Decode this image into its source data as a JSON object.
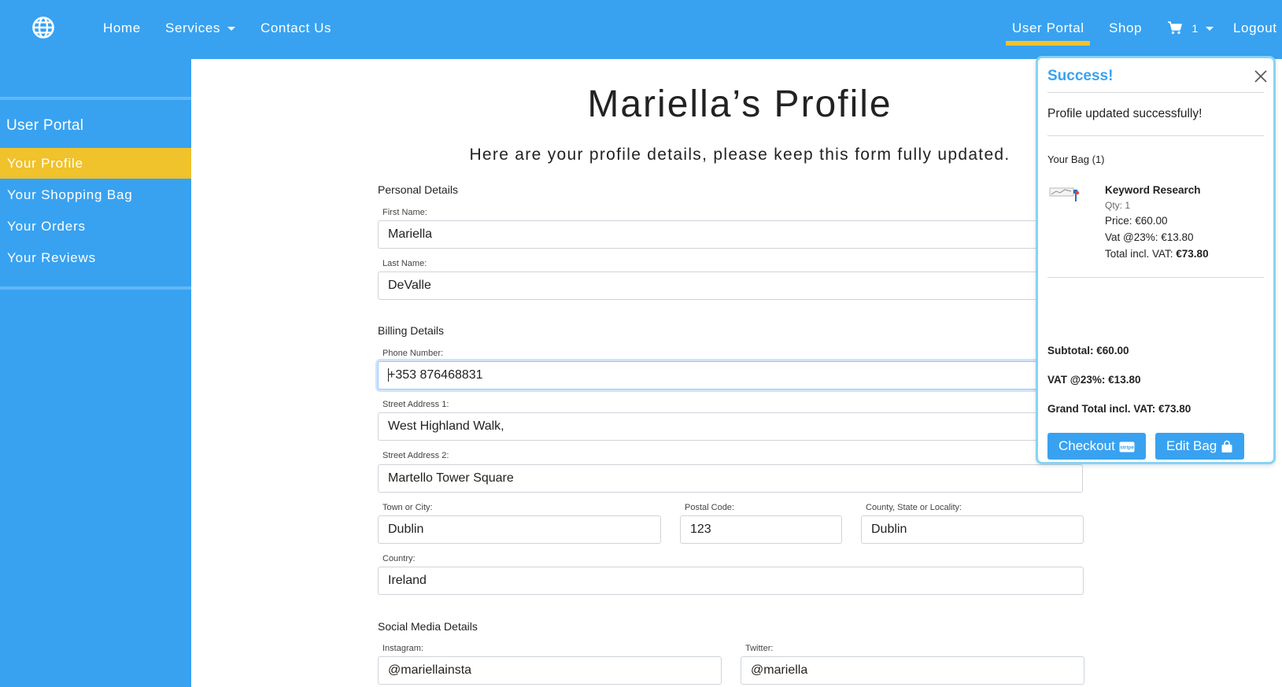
{
  "navbar": {
    "home": "Home",
    "services": "Services",
    "contact": "Contact Us",
    "user_portal": "User Portal",
    "shop": "Shop",
    "cart_count": "1",
    "logout": "Logout"
  },
  "sidebar": {
    "title": "User Portal",
    "items": [
      {
        "label": "Your Profile"
      },
      {
        "label": "Your Shopping Bag"
      },
      {
        "label": "Your Orders"
      },
      {
        "label": "Your Reviews"
      }
    ]
  },
  "profile": {
    "title": "Mariella’s Profile",
    "subtitle": "Here are your profile details, please keep this form fully updated.",
    "sections": {
      "personal": "Personal Details",
      "billing": "Billing Details",
      "social": "Social Media Details"
    },
    "fields": {
      "first_name": {
        "label": "First Name:",
        "value": "Mariella"
      },
      "last_name": {
        "label": "Last Name:",
        "value": "DeValle"
      },
      "phone": {
        "label": "Phone Number:",
        "value": "+353 876468831"
      },
      "street1": {
        "label": "Street Address 1:",
        "value": "West Highland Walk,"
      },
      "street2": {
        "label": "Street Address 2:",
        "value": "Martello Tower Square"
      },
      "town": {
        "label": "Town or City:",
        "value": "Dublin"
      },
      "postcode": {
        "label": "Postal Code:",
        "value": "123"
      },
      "county": {
        "label": "County, State or Locality:",
        "value": "Dublin"
      },
      "country": {
        "label": "Country:",
        "value": "Ireland"
      },
      "instagram": {
        "label": "Instagram:",
        "value": "@mariellainsta"
      },
      "twitter": {
        "label": "Twitter:",
        "value": "@mariella"
      }
    }
  },
  "toast": {
    "title": "Success!",
    "message": "Profile updated successfully!",
    "bag_count": "Your Bag (1)",
    "product": {
      "name": "Keyword Research",
      "qty": "Qty: 1",
      "price": "Price: €60.00",
      "vat": "Vat @23%: €13.80",
      "total_label": "Total incl. VAT: ",
      "total_value": "€73.80"
    },
    "subtotal": "Subtotal: €60.00",
    "vat": "VAT @23%: €13.80",
    "grand_total": "Grand Total incl. VAT: €73.80",
    "checkout_label": "Checkout",
    "edit_bag_label": "Edit Bag"
  },
  "colors": {
    "brand": "#38a2f1",
    "accent": "#f0c22b",
    "toast_border": "#86d3f5"
  },
  "icons": [
    "globe-icon",
    "cart-icon",
    "close-icon",
    "stripe-icon",
    "shopping-bag-icon"
  ]
}
